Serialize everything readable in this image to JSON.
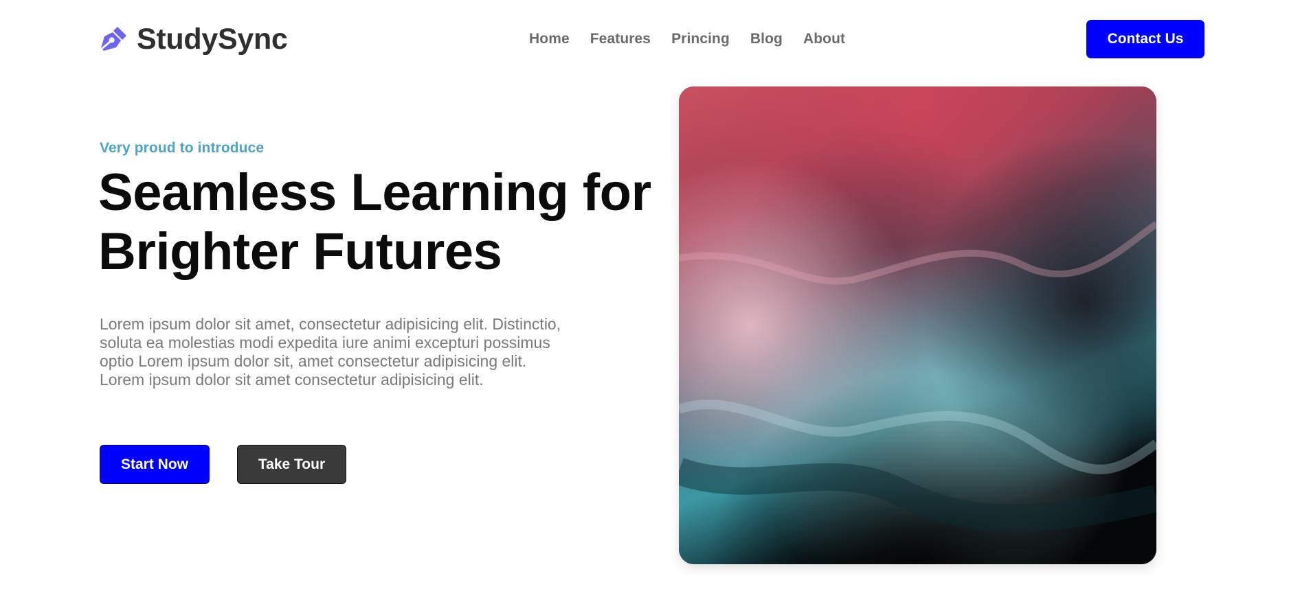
{
  "brand": {
    "name": "StudySync",
    "icon": "pen-nib-icon",
    "icon_color": "#6b63f5"
  },
  "nav": {
    "items": [
      {
        "label": "Home"
      },
      {
        "label": "Features"
      },
      {
        "label": "Princing"
      },
      {
        "label": "Blog"
      },
      {
        "label": "About"
      }
    ]
  },
  "header": {
    "contact_label": "Contact Us"
  },
  "hero": {
    "eyebrow": "Very proud to introduce",
    "headline_lines": [
      "Seamless Learning for",
      "Brighter Futures"
    ],
    "paragraph_lines": [
      "Lorem ipsum dolor sit amet, consectetur adipisicing elit. Distinctio,",
      "soluta ea molestias modi expedita iure animi excepturi possimus",
      "optio Lorem ipsum dolor sit, amet consectetur adipisicing elit.",
      "Lorem ipsum dolor sit amet consectetur adipisicing elit."
    ],
    "primary_button": "Start Now",
    "secondary_button": "Take Tour",
    "image_description_icon": "abstract-ink-image"
  },
  "colors": {
    "accent": "#0000ff",
    "eyebrow": "#4fa3c4",
    "secondary_button": "#3a3a3a",
    "image_top": "#c24a5e",
    "image_bottom": "#3fa3b0"
  }
}
